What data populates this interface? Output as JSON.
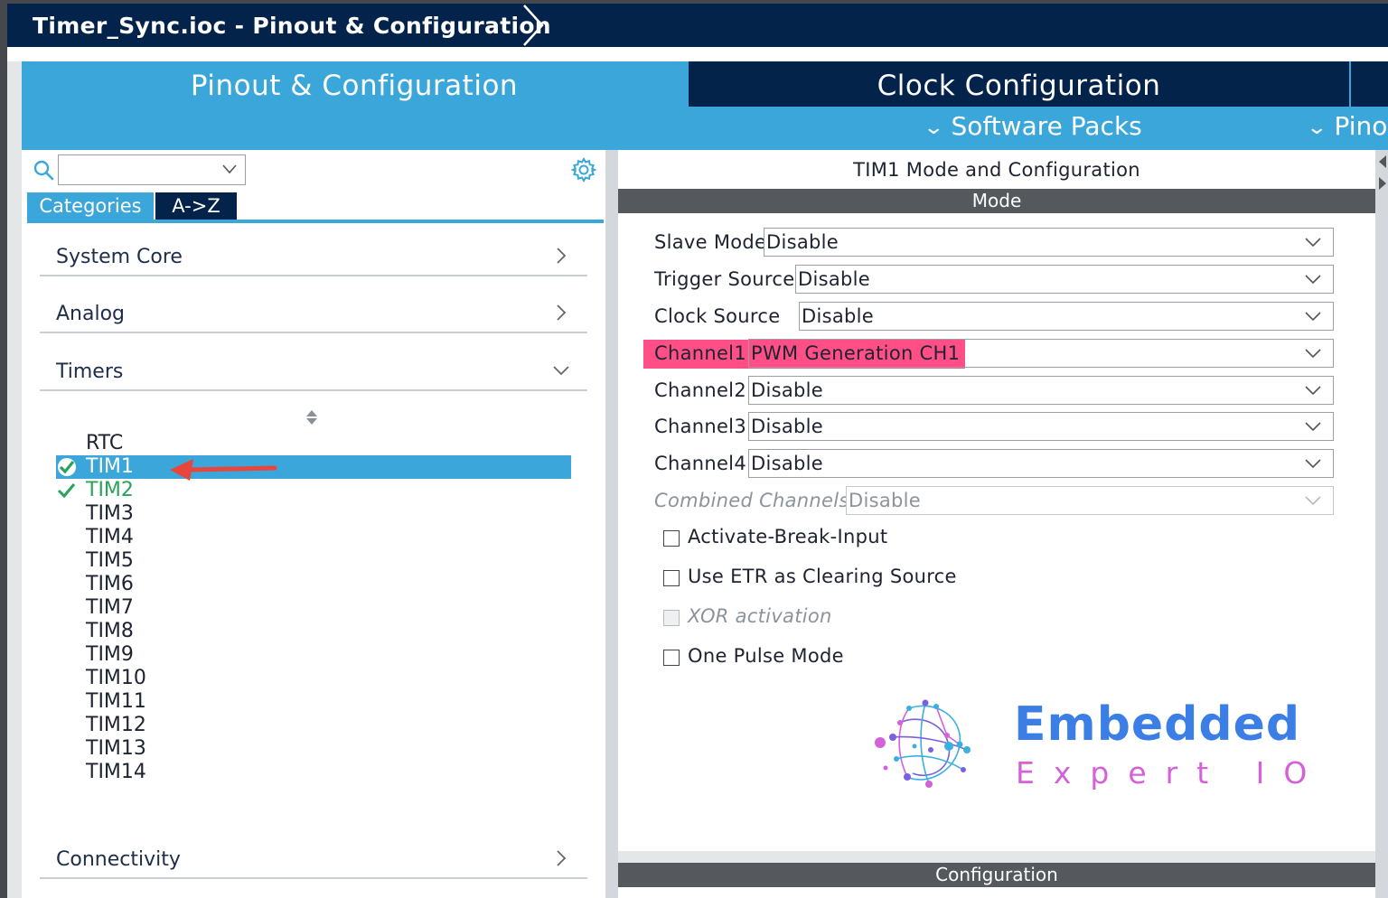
{
  "window": {
    "breadcrumb": "Timer_Sync.ioc - Pinout & Configuration"
  },
  "tabs": {
    "pinout": "Pinout & Configuration",
    "clock": "Clock Configuration",
    "software_packs": "Software Packs",
    "pinout_menu": "Pinout"
  },
  "sidebar": {
    "search_value": "",
    "categories_tab": "Categories",
    "az_tab": "A->Z",
    "categories": [
      {
        "label": "System Core",
        "expanded": false
      },
      {
        "label": "Analog",
        "expanded": false
      },
      {
        "label": "Timers",
        "expanded": true
      },
      {
        "label": "Connectivity",
        "expanded": false
      }
    ],
    "timers": [
      {
        "label": "RTC",
        "state": "none"
      },
      {
        "label": "TIM1",
        "state": "selected-configured"
      },
      {
        "label": "TIM2",
        "state": "configured"
      },
      {
        "label": "TIM3",
        "state": "none"
      },
      {
        "label": "TIM4",
        "state": "none"
      },
      {
        "label": "TIM5",
        "state": "none"
      },
      {
        "label": "TIM6",
        "state": "none"
      },
      {
        "label": "TIM7",
        "state": "none"
      },
      {
        "label": "TIM8",
        "state": "none"
      },
      {
        "label": "TIM9",
        "state": "none"
      },
      {
        "label": "TIM10",
        "state": "none"
      },
      {
        "label": "TIM11",
        "state": "none"
      },
      {
        "label": "TIM12",
        "state": "none"
      },
      {
        "label": "TIM13",
        "state": "none"
      },
      {
        "label": "TIM14",
        "state": "none"
      }
    ]
  },
  "panel": {
    "title": "TIM1 Mode and Configuration",
    "mode_header": "Mode",
    "config_header": "Configuration",
    "fields": [
      {
        "label": "Slave Mode",
        "value": "Disable",
        "disabled": false
      },
      {
        "label": "Trigger Source",
        "value": "Disable",
        "disabled": false
      },
      {
        "label": "Clock Source",
        "value": "Disable",
        "disabled": false
      },
      {
        "label": "Channel1",
        "value": "PWM Generation CH1",
        "disabled": false,
        "highlighted": true
      },
      {
        "label": "Channel2",
        "value": "Disable",
        "disabled": false
      },
      {
        "label": "Channel3",
        "value": "Disable",
        "disabled": false
      },
      {
        "label": "Channel4",
        "value": "Disable",
        "disabled": false
      },
      {
        "label": "Combined Channels",
        "value": "Disable",
        "disabled": true
      }
    ],
    "checkboxes": [
      {
        "label": "Activate-Break-Input",
        "checked": false,
        "disabled": false
      },
      {
        "label": "Use ETR as Clearing Source",
        "checked": false,
        "disabled": false
      },
      {
        "label": "XOR activation",
        "checked": false,
        "disabled": true
      },
      {
        "label": "One Pulse Mode",
        "checked": false,
        "disabled": false
      }
    ]
  },
  "watermark": {
    "title": "Embedded",
    "subtitle": "Expert IO"
  },
  "colors": {
    "navy": "#03234b",
    "accent_blue": "#3ba6d9",
    "configured_green": "#27a35a",
    "highlight_pink": "#ff4f86",
    "annotation_red": "#e8453c"
  },
  "icons": [
    "search-icon",
    "gear-icon",
    "chevron-right-icon",
    "chevron-down-icon",
    "check-icon",
    "sort-icon"
  ]
}
